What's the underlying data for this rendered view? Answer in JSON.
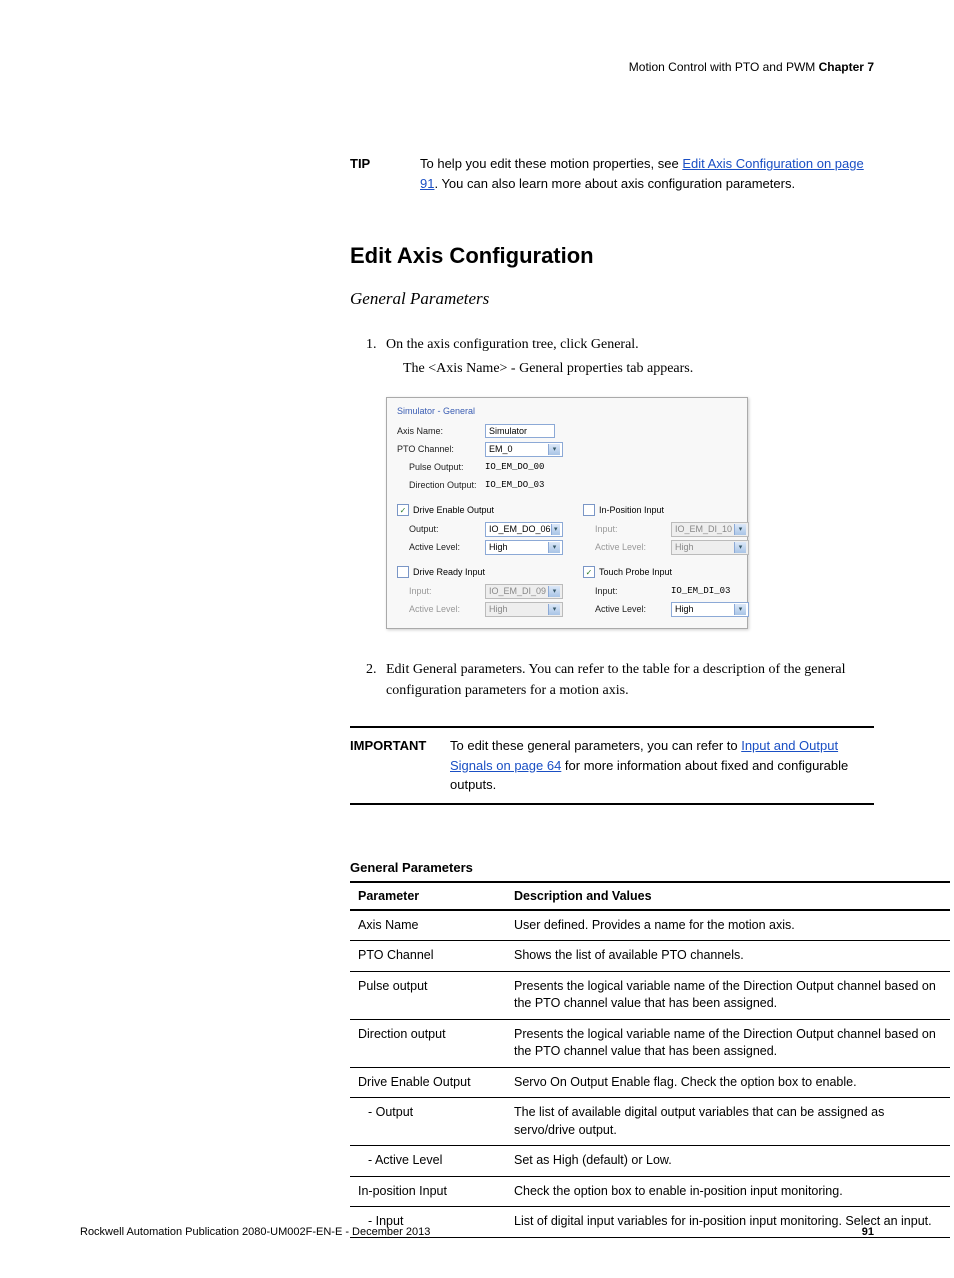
{
  "header": {
    "text_pre": "Motion Control with PTO and PWM ",
    "chapter": "Chapter 7"
  },
  "tip": {
    "label": "TIP",
    "body_pre": "To help you edit these motion properties, see ",
    "link": "Edit Axis Configuration on page 91",
    "body_post": ". You can also learn more about axis configuration parameters."
  },
  "section_title": "Edit Axis Configuration",
  "sub_title": "General Parameters",
  "steps": {
    "s1": "On the axis configuration tree, click General.",
    "s1_extra": "The <Axis Name> - General properties tab appears.",
    "s2": "Edit General parameters. You can refer to the table for a description of the general configuration parameters for a motion axis."
  },
  "figure": {
    "title": "Simulator - General",
    "rows": {
      "axis_name_lbl": "Axis Name:",
      "axis_name_val": "Simulator",
      "pto_lbl": "PTO Channel:",
      "pto_val": "EM_0",
      "pulse_lbl": "Pulse Output:",
      "pulse_val": "IO_EM_DO_00",
      "dir_lbl": "Direction Output:",
      "dir_val": "IO_EM_DO_03",
      "deo_lbl": "Drive Enable Output",
      "deo_out_lbl": "Output:",
      "deo_out_val": "IO_EM_DO_06",
      "deo_lvl_lbl": "Active Level:",
      "deo_lvl_val": "High",
      "dri_lbl": "Drive Ready Input",
      "dri_in_lbl": "Input:",
      "dri_in_val": "IO_EM_DI_09",
      "dri_lvl_lbl": "Active Level:",
      "dri_lvl_val": "High",
      "ipi_lbl": "In-Position Input",
      "ipi_in_lbl": "Input:",
      "ipi_in_val": "IO_EM_DI_10",
      "ipi_lvl_lbl": "Active Level:",
      "ipi_lvl_val": "High",
      "tpi_lbl": "Touch Probe Input",
      "tpi_in_lbl": "Input:",
      "tpi_in_val": "IO_EM_DI_03",
      "tpi_lvl_lbl": "Active Level:",
      "tpi_lvl_val": "High"
    }
  },
  "important": {
    "label": "IMPORTANT",
    "body_pre": "To edit these general parameters, you can refer to ",
    "link": "Input and Output Signals on page 64",
    "body_post": " for more information about fixed and configurable outputs."
  },
  "table": {
    "title": "General Parameters",
    "head": {
      "c1": "Parameter",
      "c2": "Description and Values"
    },
    "rows": [
      {
        "p": "Axis Name",
        "d": "User defined. Provides a name for the motion axis."
      },
      {
        "p": "PTO Channel",
        "d": "Shows the list of available PTO channels."
      },
      {
        "p": "Pulse output",
        "d": "Presents the logical variable name of the Direction Output channel based on the PTO channel value that has been assigned."
      },
      {
        "p": "Direction output",
        "d": "Presents the logical variable name of the Direction Output channel based on the PTO channel value that has been assigned."
      },
      {
        "p": "Drive Enable Output",
        "d": "Servo On Output Enable flag. Check the option box to enable."
      },
      {
        "p": "- Output",
        "d": "The list of available digital output variables that can be assigned as servo/drive output.",
        "indent": true
      },
      {
        "p": "- Active Level",
        "d": "Set as High (default) or Low.",
        "indent": true
      },
      {
        "p": "In-position Input",
        "d": "Check the option box to enable in-position input monitoring."
      },
      {
        "p": "- Input",
        "d": "List of digital input variables for in-position input monitoring. Select an input.",
        "indent": true
      }
    ]
  },
  "footer": {
    "pub": "Rockwell Automation Publication 2080-UM002F-EN-E - December 2013",
    "page": "91"
  }
}
